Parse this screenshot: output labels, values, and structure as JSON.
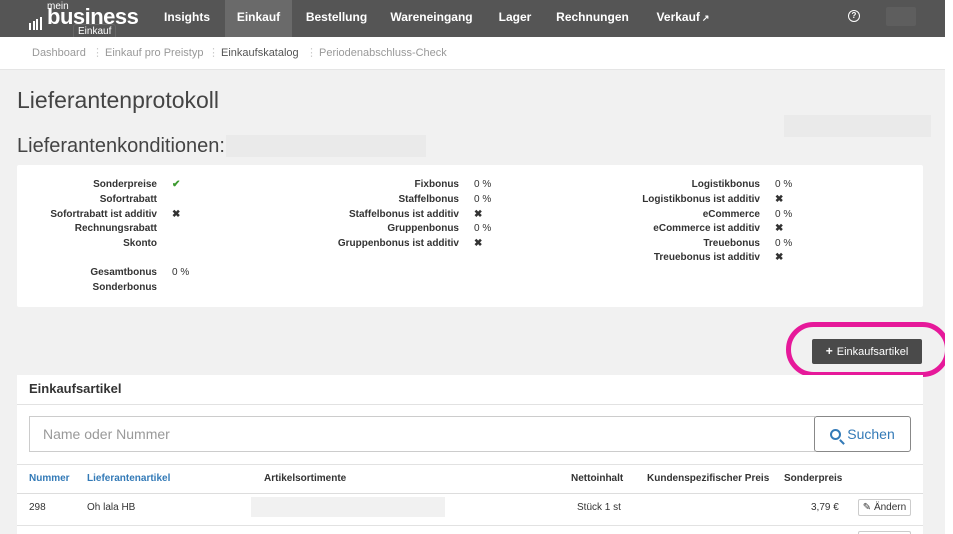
{
  "brand": {
    "mein": "mein",
    "word": "business",
    "badge": "Einkauf"
  },
  "nav": {
    "items": [
      {
        "label": "Insights"
      },
      {
        "label": "Einkauf"
      },
      {
        "label": "Bestellung"
      },
      {
        "label": "Wareneingang"
      },
      {
        "label": "Lager"
      },
      {
        "label": "Rechnungen"
      },
      {
        "label": "Verkauf"
      }
    ],
    "external_icon": "↗",
    "help_icon": "?"
  },
  "breadcrumb": [
    "Dashboard",
    "Einkauf pro Preistyp",
    "Einkaufskatalog",
    "Periodenabschluss-Check"
  ],
  "page": {
    "title": "Lieferantenprotokoll",
    "conditions_title": "Lieferantenkonditionen:"
  },
  "conditions": {
    "col1": [
      {
        "label": "Sonderpreise",
        "value": "✔"
      },
      {
        "label": "Sofortrabatt",
        "value": ""
      },
      {
        "label": "Sofortrabatt ist additiv",
        "value": "✖"
      },
      {
        "label": "Rechnungsrabatt",
        "value": ""
      },
      {
        "label": "Skonto",
        "value": ""
      },
      {
        "label": "Gesamtbonus",
        "value": "0 %"
      },
      {
        "label": "Sonderbonus",
        "value": ""
      }
    ],
    "col2": [
      {
        "label": "Fixbonus",
        "value": "0 %"
      },
      {
        "label": "Staffelbonus",
        "value": "0 %"
      },
      {
        "label": "Staffelbonus ist additiv",
        "value": "✖"
      },
      {
        "label": "Gruppenbonus",
        "value": "0 %"
      },
      {
        "label": "Gruppenbonus ist additiv",
        "value": "✖"
      }
    ],
    "col3": [
      {
        "label": "Logistikbonus",
        "value": "0 %"
      },
      {
        "label": "Logistikbonus ist additiv",
        "value": "✖"
      },
      {
        "label": "eCommerce",
        "value": "0 %"
      },
      {
        "label": "eCommerce ist additiv",
        "value": "✖"
      },
      {
        "label": "Treuebonus",
        "value": "0 %"
      },
      {
        "label": "Treuebonus ist additiv",
        "value": "✖"
      }
    ]
  },
  "actions": {
    "add_label": "Einkaufsartikel",
    "add_icon": "+"
  },
  "articles": {
    "title": "Einkaufsartikel",
    "search_placeholder": "Name oder Nummer",
    "search_label": "Suchen",
    "columns": {
      "nummer": "Nummer",
      "lieferantenartikel": "Lieferantenartikel",
      "sortimente": "Artikelsortimente",
      "nettoinhalt": "Nettoinhalt",
      "kundenpreis": "Kundenspezifischer Preis",
      "sonderpreis": "Sonderpreis"
    },
    "rows": [
      {
        "nummer": "298",
        "name": "Oh lala HB",
        "nettoinhalt": "Stück 1 st",
        "sonderpreis": "3,79 €",
        "edit": "Ändern"
      }
    ]
  }
}
